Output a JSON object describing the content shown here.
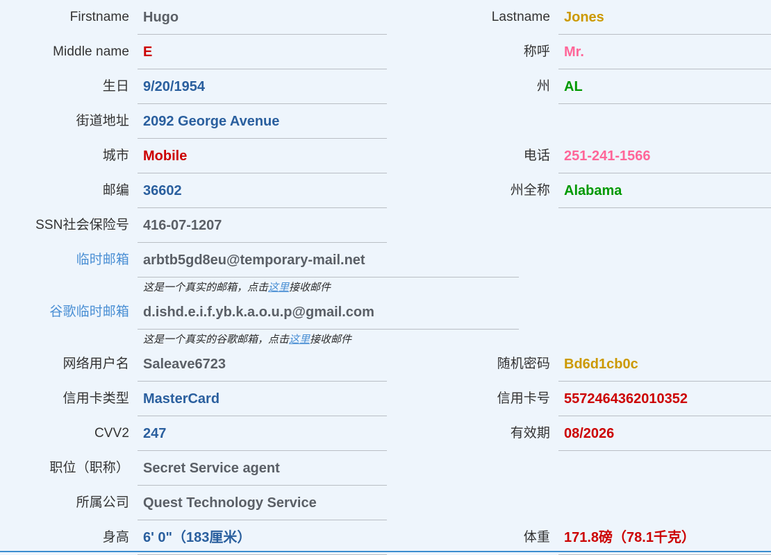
{
  "palette": {
    "page_bg": "#eef5fc",
    "label": "#333333",
    "link": "#4a8fd4",
    "rule": "#b9bec4",
    "bottom_rule": "#3b8dcf",
    "gray": "#5a5f66",
    "blue": "#2a5f9e",
    "red": "#cc0000",
    "darkred": "#cc1111",
    "green": "#009900",
    "pink": "#ff6699",
    "gold": "#cc9900"
  },
  "rows": [
    {
      "left": {
        "label": "Firstname",
        "value": "Hugo",
        "color": "#5a5f66"
      },
      "right": {
        "label": "Lastname",
        "value": "Jones",
        "color": "#cc9900"
      }
    },
    {
      "left": {
        "label": "Middle name",
        "value": "E",
        "color": "#cc0000"
      },
      "right": {
        "label": "称呼",
        "value": "Mr.",
        "color": "#ff6699"
      }
    },
    {
      "left": {
        "label": "生日",
        "value": "9/20/1954",
        "color": "#2a5f9e"
      },
      "right": {
        "label": "州",
        "value": "AL",
        "color": "#009900"
      }
    },
    {
      "left": {
        "label": "街道地址",
        "value": "2092 George Avenue",
        "color": "#2a5f9e"
      },
      "right": {
        "label": "",
        "value": "",
        "color": ""
      }
    },
    {
      "left": {
        "label": "城市",
        "value": "Mobile",
        "color": "#cc0000"
      },
      "right": {
        "label": "电话",
        "value": "251-241-1566",
        "color": "#ff6699"
      }
    },
    {
      "left": {
        "label": "邮编",
        "value": "36602",
        "color": "#2a5f9e"
      },
      "right": {
        "label": "州全称",
        "value": "Alabama",
        "color": "#009900"
      }
    },
    {
      "left": {
        "label": "SSN社会保险号",
        "value": "416-07-1207",
        "color": "#5a5f66"
      },
      "right": {
        "label": "",
        "value": "",
        "color": ""
      }
    }
  ],
  "email_rows": [
    {
      "label": "临时邮箱",
      "value": "arbtb5gd8eu@temporary-mail.net",
      "color": "#5a5f66",
      "note_before": "这是一个真实的邮箱，点击",
      "note_link": "这里",
      "note_after": "接收邮件"
    },
    {
      "label": "谷歌临时邮箱",
      "value": "d.ishd.e.i.f.yb.k.a.o.u.p@gmail.com",
      "color": "#5a5f66",
      "note_before": "这是一个真实的谷歌邮箱，点击",
      "note_link": "这里",
      "note_after": "接收邮件"
    }
  ],
  "rows2": [
    {
      "left": {
        "label": "网络用户名",
        "value": "Saleave6723",
        "color": "#5a5f66"
      },
      "right": {
        "label": "随机密码",
        "value": "Bd6d1cb0c",
        "color": "#cc9900"
      }
    },
    {
      "left": {
        "label": "信用卡类型",
        "value": "MasterCard",
        "color": "#2a5f9e"
      },
      "right": {
        "label": "信用卡号",
        "value": "5572464362010352",
        "color": "#cc0000"
      }
    },
    {
      "left": {
        "label": "CVV2",
        "value": "247",
        "color": "#2a5f9e"
      },
      "right": {
        "label": "有效期",
        "value": "08/2026",
        "color": "#cc0000"
      }
    },
    {
      "left": {
        "label": "职位（职称）",
        "value": "Secret Service agent",
        "color": "#5a5f66"
      },
      "right": {
        "label": "",
        "value": "",
        "color": ""
      }
    },
    {
      "left": {
        "label": "所属公司",
        "value": "Quest Technology Service",
        "color": "#5a5f66"
      },
      "right": {
        "label": "",
        "value": "",
        "color": ""
      }
    },
    {
      "left": {
        "label": "身高",
        "value": "6' 0\"（183厘米）",
        "color": "#2a5f9e"
      },
      "right": {
        "label": "体重",
        "value": "171.8磅（78.1千克）",
        "color": "#cc0000"
      }
    }
  ]
}
